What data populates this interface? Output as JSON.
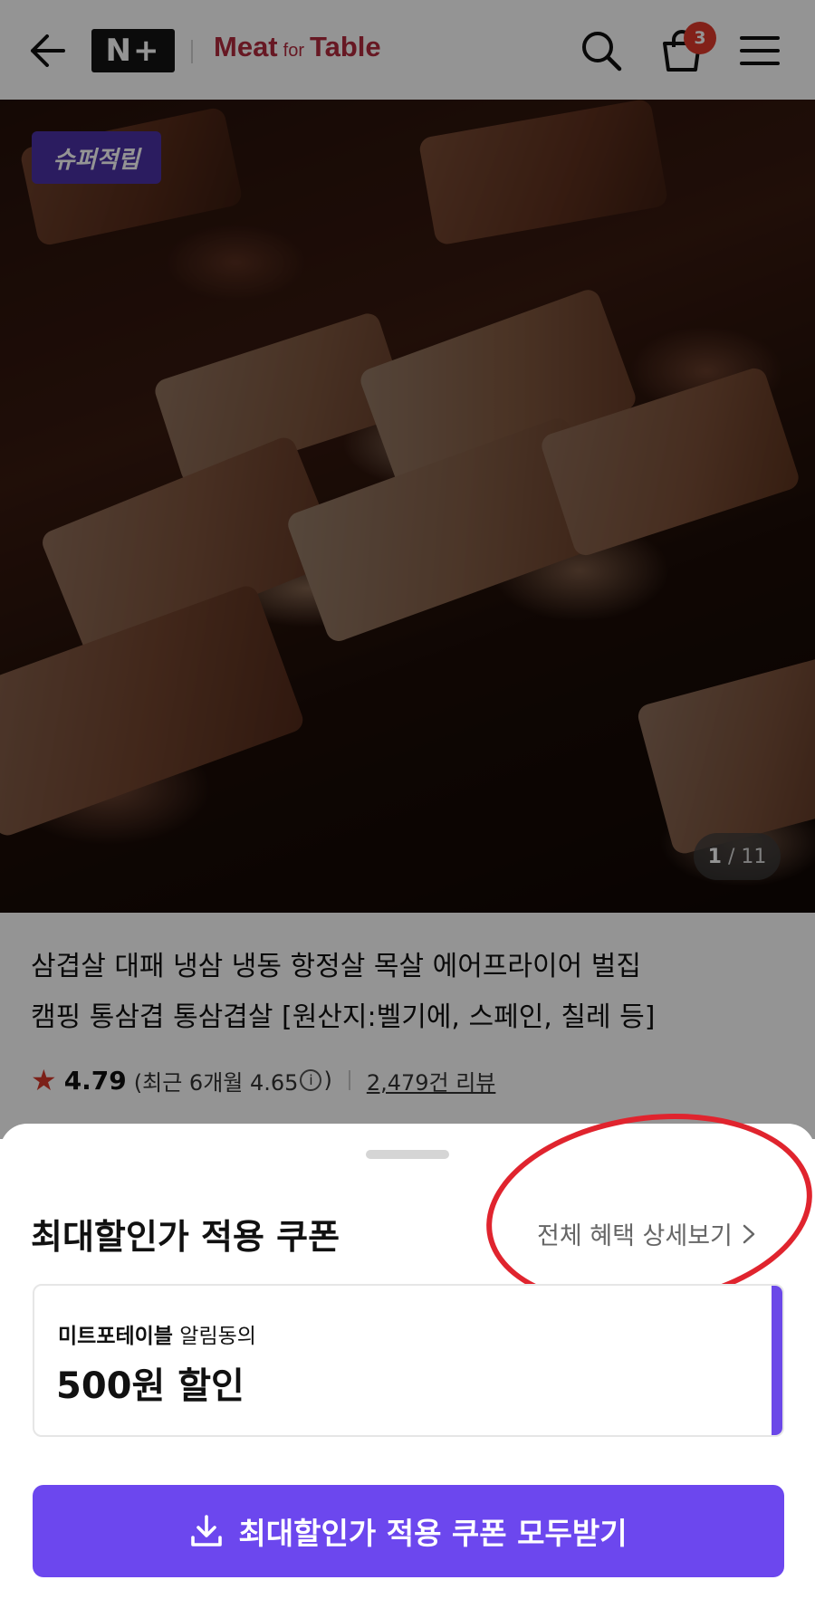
{
  "header": {
    "brand_badge": "N+",
    "brand_name_left": "Meat",
    "brand_name_mid": "for",
    "brand_name_right": "Table",
    "cart_count": "3",
    "icons": [
      "back-arrow-icon",
      "search-icon",
      "cart-icon",
      "menu-icon"
    ]
  },
  "hero": {
    "badge": "슈퍼적립",
    "page_current": "1",
    "page_sep": " / ",
    "page_total": "11"
  },
  "product": {
    "title_line1": "삼겹살 대패 냉삼 냉동 항정살 목살 에어프라이어 벌집",
    "title_line2": "캠핑 통삼겹 통삼겹살 [원산지:벨기에, 스페인, 칠레 등]",
    "rating": "4.79",
    "recent_prefix": "(최근 6개월 4.65",
    "recent_suffix": ")",
    "info_icon": "i",
    "review_count": "2,479건 리뷰"
  },
  "sheet": {
    "title": "최대할인가 적용 쿠폰",
    "detail_link": "전체 혜택 상세보기",
    "coupon": {
      "store_name": "미트포테이블",
      "store_suffix": " 알림동의",
      "amount": "500원 할인"
    },
    "download_button": "최대할인가 적용 쿠폰 모두받기"
  },
  "colors": {
    "accent": "#6c47ee",
    "brand": "#b22a3d",
    "badge_bg": "#4b31a6",
    "cart_badge": "#e0392b",
    "annotation_circle": "#e0242e"
  }
}
